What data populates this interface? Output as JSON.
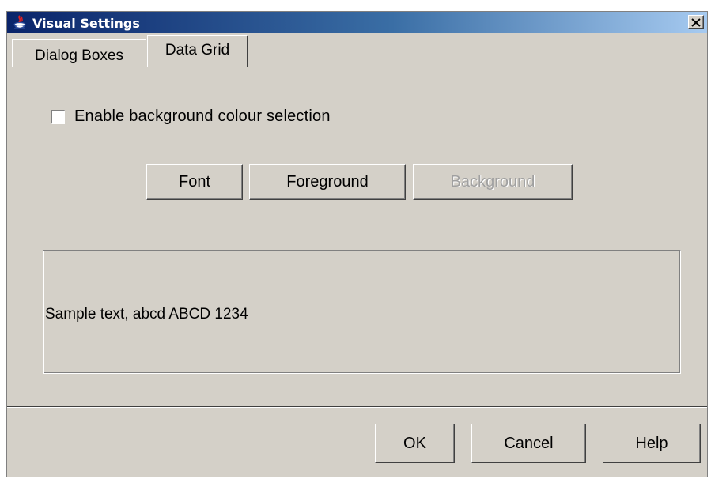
{
  "window": {
    "title": "Visual Settings",
    "close_label": "✕"
  },
  "tabs": [
    {
      "label": "Dialog Boxes",
      "active": false
    },
    {
      "label": "Data Grid",
      "active": true
    }
  ],
  "panel": {
    "checkbox_label": "Enable background colour selection",
    "checkbox_checked": false,
    "buttons": {
      "font": "Font",
      "foreground": "Foreground",
      "background": "Background"
    },
    "sample_text": "Sample text, abcd ABCD 1234"
  },
  "footer": {
    "ok": "OK",
    "cancel": "Cancel",
    "help": "Help"
  },
  "colors": {
    "titlebar_start": "#0a246a",
    "titlebar_end": "#a6caf0",
    "face": "#d4d0c8"
  }
}
